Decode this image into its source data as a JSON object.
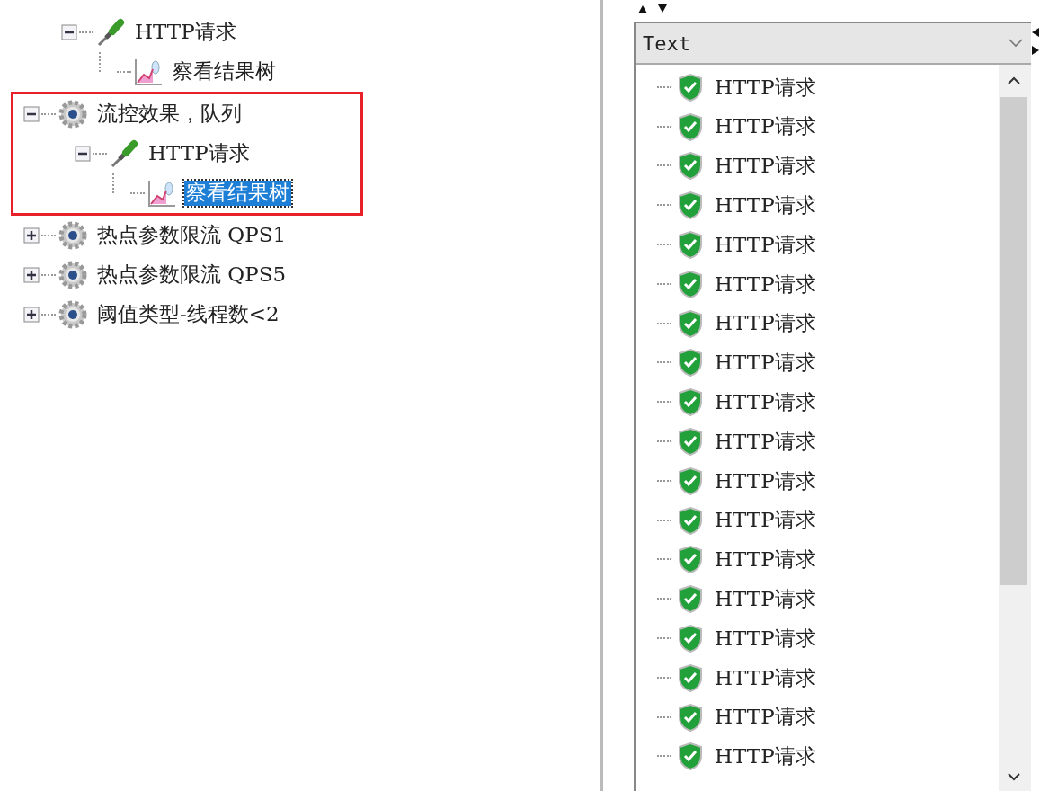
{
  "test_plan_tree": {
    "nodes": [
      {
        "kind": "offscreen",
        "children": [
          {
            "label": "HTTP请求",
            "kind": "sampler",
            "expanded": true,
            "selected": false,
            "highlighted": false,
            "children": [
              {
                "label": "察看结果树",
                "kind": "listener",
                "selected": false,
                "highlighted": false
              }
            ]
          }
        ]
      },
      {
        "label": "流控效果，队列",
        "kind": "thread_group",
        "expanded": true,
        "selected": false,
        "highlighted": true,
        "children": [
          {
            "label": "HTTP请求",
            "kind": "sampler",
            "expanded": true,
            "selected": false,
            "highlighted": false,
            "children": [
              {
                "label": "察看结果树",
                "kind": "listener",
                "selected": true,
                "highlighted": false
              }
            ]
          }
        ]
      },
      {
        "label": "热点参数限流 QPS1",
        "kind": "thread_group",
        "expanded": false,
        "selected": false,
        "highlighted": false
      },
      {
        "label": "热点参数限流 QPS5",
        "kind": "thread_group",
        "expanded": false,
        "selected": false,
        "highlighted": false
      },
      {
        "label": "阈值类型-线程数<2",
        "kind": "thread_group",
        "expanded": false,
        "selected": false,
        "highlighted": false
      }
    ]
  },
  "results_panel": {
    "view_select": {
      "value": "Text"
    },
    "results": [
      {
        "label": "HTTP请求",
        "passed": true
      },
      {
        "label": "HTTP请求",
        "passed": true
      },
      {
        "label": "HTTP请求",
        "passed": true
      },
      {
        "label": "HTTP请求",
        "passed": true
      },
      {
        "label": "HTTP请求",
        "passed": true
      },
      {
        "label": "HTTP请求",
        "passed": true
      },
      {
        "label": "HTTP请求",
        "passed": true
      },
      {
        "label": "HTTP请求",
        "passed": true
      },
      {
        "label": "HTTP请求",
        "passed": true
      },
      {
        "label": "HTTP请求",
        "passed": true
      },
      {
        "label": "HTTP请求",
        "passed": true
      },
      {
        "label": "HTTP请求",
        "passed": true
      },
      {
        "label": "HTTP请求",
        "passed": true
      },
      {
        "label": "HTTP请求",
        "passed": true
      },
      {
        "label": "HTTP请求",
        "passed": true
      },
      {
        "label": "HTTP请求",
        "passed": true
      },
      {
        "label": "HTTP请求",
        "passed": true
      },
      {
        "label": "HTTP请求",
        "passed": true
      }
    ]
  }
}
